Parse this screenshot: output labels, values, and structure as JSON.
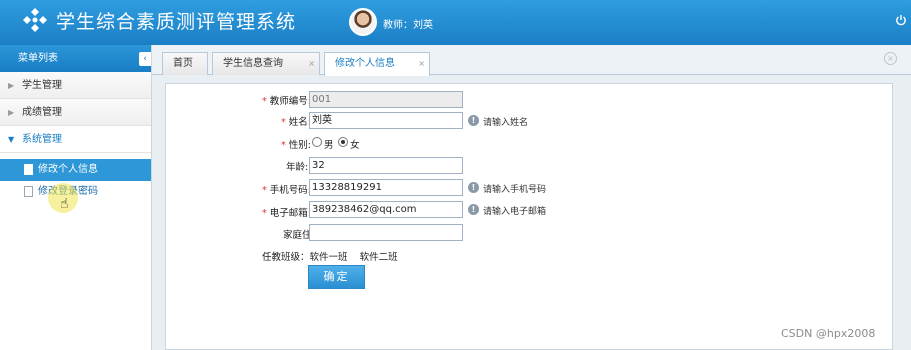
{
  "header": {
    "title": "学生综合素质测评管理系统",
    "user_label": "教师：刘英"
  },
  "sidebar": {
    "title": "菜单列表",
    "collapse_icon": "‹",
    "groups": [
      {
        "label": "学生管理"
      },
      {
        "label": "成绩管理"
      },
      {
        "label": "系统管理"
      }
    ],
    "subitems": [
      {
        "label": "修改个人信息"
      },
      {
        "label": "修改登录密码"
      }
    ]
  },
  "tabs": [
    {
      "label": "首页"
    },
    {
      "label": "学生信息查询"
    },
    {
      "label": "修改个人信息"
    }
  ],
  "form": {
    "teacher_id": {
      "label": "教师编号:",
      "value": "001"
    },
    "name": {
      "label": "姓名:",
      "value": "刘英",
      "hint": "请输入姓名"
    },
    "gender": {
      "label": "性别:",
      "male": "男",
      "female": "女"
    },
    "age": {
      "label": "年龄:",
      "value": "32"
    },
    "phone": {
      "label": "手机号码:",
      "value": "13328819291",
      "hint": "请输入手机号码"
    },
    "email": {
      "label": "电子邮箱:",
      "value": "389238462@qq.com",
      "hint": "请输入电子邮箱"
    },
    "address": {
      "label": "家庭住址:",
      "value": ""
    },
    "classes": {
      "label": "任教班级：",
      "value": "软件一班    软件二班"
    },
    "submit": "确定"
  },
  "watermark": "CSDN @hpx2008",
  "colors": {
    "accent": "#1a7ec4",
    "header": "#2f9de0",
    "required": "#d33333"
  }
}
